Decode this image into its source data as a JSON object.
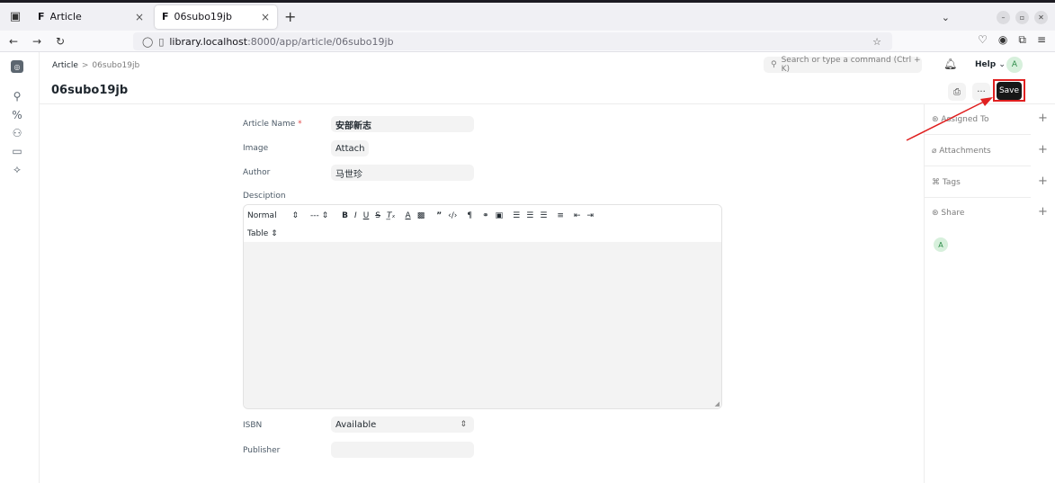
{
  "browser": {
    "tabs": [
      {
        "favicon": "F",
        "title": "Article",
        "active": false
      },
      {
        "favicon": "F",
        "title": "06subo19jb",
        "active": true
      }
    ],
    "close_glyph": "×",
    "new_tab_glyph": "+",
    "url_host": "library.localhost",
    "url_path": ":8000/app/article/06subo19jb"
  },
  "app": {
    "breadcrumb": {
      "root": "Article",
      "separator": ">",
      "current": "06subo19jb"
    },
    "search_placeholder": "Search or type a command (Ctrl + K)",
    "help_label": "Help",
    "user_initial": "A"
  },
  "page": {
    "title": "06subo19jb",
    "save_label": "Save",
    "more_label": "···"
  },
  "form": {
    "article_name": {
      "label": "Article Name",
      "required_mark": "*",
      "value": "安部新志"
    },
    "image": {
      "label": "Image",
      "button": "Attach"
    },
    "author": {
      "label": "Author",
      "value": "马世珍"
    },
    "description": {
      "label": "Desciption"
    },
    "editor_toolbar": {
      "format": "Normal",
      "size": "---",
      "table": "Table"
    },
    "isbn": {
      "label": "ISBN",
      "value": "Available"
    },
    "publisher": {
      "label": "Publisher",
      "value": ""
    }
  },
  "sidebar": {
    "items": [
      {
        "label": "Assigned To"
      },
      {
        "label": "Attachments"
      },
      {
        "label": "Tags"
      },
      {
        "label": "Share"
      }
    ],
    "plus_glyph": "+",
    "user_initial": "A"
  },
  "annotation": {
    "highlight_color": "#e02020"
  }
}
